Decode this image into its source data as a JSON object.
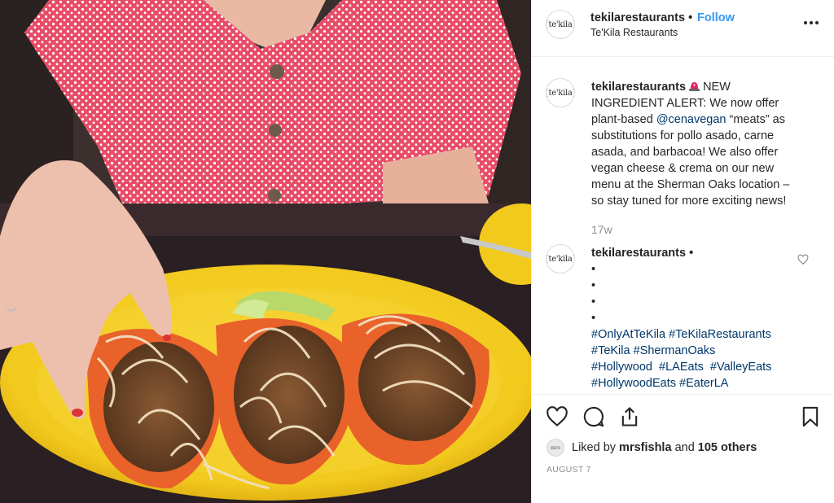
{
  "post": {
    "username": "tekilarestaurants",
    "separator": "•",
    "follow_label": "Follow",
    "location": "Te'Kila Restaurants",
    "more_icon": "more-horizontal-icon",
    "avatar_logo": "{te'kila}"
  },
  "caption": {
    "username": "tekilarestaurants",
    "line1_after_emoji": "NEW",
    "line2": "INGREDIENT ALERT: We now offer",
    "line3_pre": "plant-based ",
    "mention": "@cenavegan",
    "line3_post": " “meats” as",
    "line4": "substitutions for pollo asado, carne",
    "line5": "asada, and barbacoa! We also offer",
    "line6": "vegan cheese & crema on our new",
    "line7": "menu at the Sherman Oaks location –",
    "line8": "so stay tuned for more exciting news!",
    "emoji_icon": "police-light-icon",
    "age": "17w"
  },
  "comment": {
    "username": "tekilarestaurants",
    "separator": "•",
    "bullets": [
      "•",
      "•",
      "•",
      "•"
    ],
    "hashtags_line1": [
      "#OnlyAtTeKila",
      "#TeKilaRestaurants"
    ],
    "hashtags_line2": [
      "#TeKila",
      "#ShermanOaks"
    ],
    "hashtags_line3": [
      "#Hollywood",
      "#LAEats",
      "#ValleyEats"
    ],
    "hashtags_line4": [
      "#HollywoodEats",
      "#EaterLA"
    ],
    "like_icon": "heart-outline-icon"
  },
  "actions": {
    "like_icon": "heart-icon",
    "comment_icon": "comment-icon",
    "share_icon": "share-icon",
    "save_icon": "bookmark-icon"
  },
  "likes": {
    "prefix": "Liked by",
    "user": "mrsfishla",
    "and": "and",
    "others": "105 others",
    "mini_avatar": "mrs"
  },
  "date": "AUGUST 7",
  "colors": {
    "link": "#00376b",
    "follow": "#3897f0",
    "muted": "#8e8e8e",
    "plate": "#f3cf2a",
    "shirt": "#e84d68",
    "tortilla": "#e8622a"
  }
}
